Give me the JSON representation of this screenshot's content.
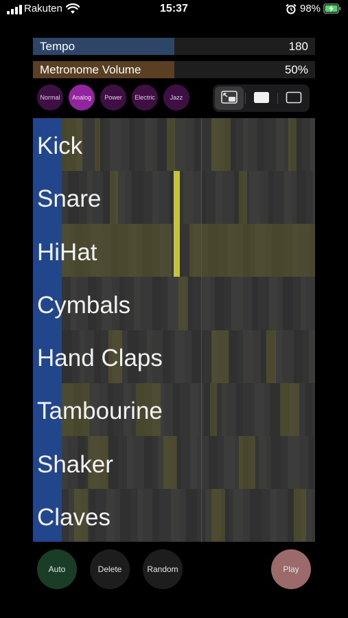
{
  "status_bar": {
    "carrier": "Rakuten",
    "time": "15:37",
    "battery": "98%"
  },
  "sliders": {
    "tempo": {
      "label": "Tempo",
      "value": "180",
      "fill_fraction": 0.5
    },
    "metronome": {
      "label": "Metronome Volume",
      "value": "50%",
      "fill_fraction": 0.5
    }
  },
  "kits": {
    "items": [
      "Normal",
      "Analog",
      "Power",
      "Electric",
      "Jazz"
    ],
    "selected": "Analog"
  },
  "view_modes": {
    "icons": [
      "pip-icon",
      "fill-view-icon",
      "frame-view-icon"
    ],
    "selected": "pip-icon"
  },
  "grid": {
    "tracks": [
      "Kick",
      "Snare",
      "HiHat",
      "Cymbals",
      "Hand Claps",
      "Tambourine",
      "Shaker",
      "Claves"
    ],
    "playhead_fraction": 0.55
  },
  "controls": {
    "auto": "Auto",
    "delete": "Delete",
    "random": "Random",
    "play": "Play"
  },
  "colors": {
    "accent_kit": "#92259e",
    "playhead": "#c62020",
    "track_bar": "#22468c",
    "step_active": "#5c5a2c",
    "step_highlight": "#c9c42e"
  }
}
